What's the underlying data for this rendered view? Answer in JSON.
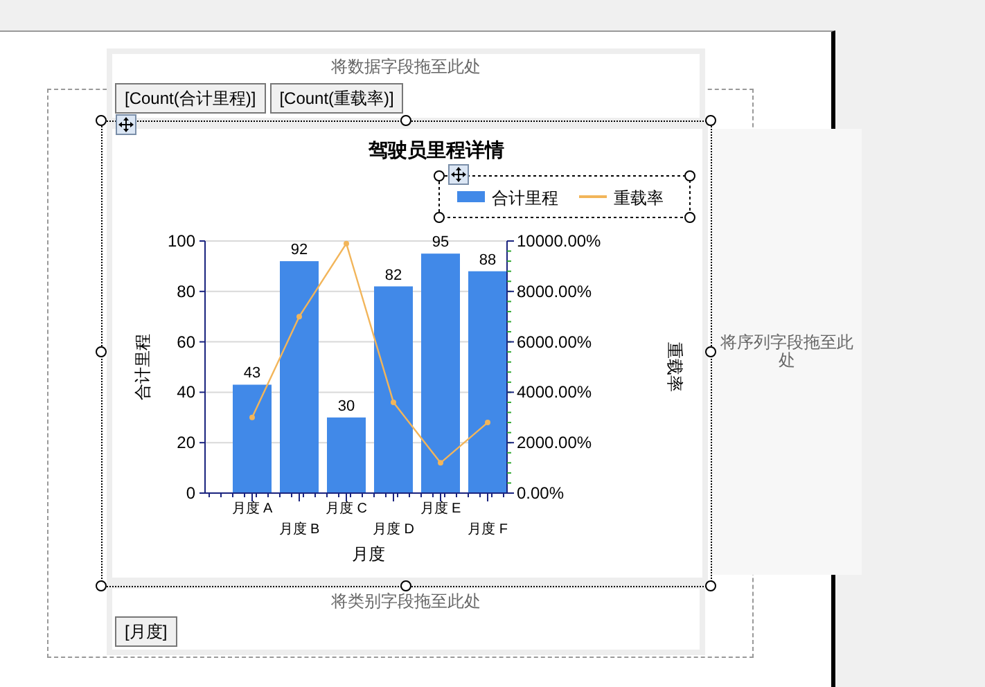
{
  "data_zone": {
    "hint": "将数据字段拖至此处",
    "fields": [
      "[Count(合计里程)]",
      "[Count(重载率)]"
    ]
  },
  "series_zone": {
    "hint": "将序列字段拖至此处"
  },
  "category_zone": {
    "hint": "将类别字段拖至此处",
    "fields": [
      "[月度]"
    ]
  },
  "chart": {
    "chart_data": {
      "type": "bar",
      "title": "驾驶员里程详情",
      "xlabel": "月度",
      "ylabel": "合计里程",
      "y2label": "重载率",
      "categories": [
        "月度 A",
        "月度 B",
        "月度 C",
        "月度 D",
        "月度 E",
        "月度 F"
      ],
      "series": [
        {
          "name": "合计里程",
          "type": "bar",
          "color": "#4189e8",
          "values": [
            43,
            92,
            30,
            82,
            95,
            88
          ],
          "value_labels": [
            "43",
            "92",
            "30",
            "82",
            "95",
            "88"
          ]
        },
        {
          "name": "重载率",
          "type": "line",
          "color": "#f2b55a",
          "values": [
            30,
            70,
            99,
            36,
            12,
            28
          ],
          "marker": true,
          "value_labels": [
            null,
            null,
            null,
            null,
            null,
            null
          ]
        }
      ],
      "ylim": [
        0,
        100
      ],
      "yticks": [
        0,
        20,
        40,
        60,
        80,
        100
      ],
      "y2lim": [
        0,
        100
      ],
      "y2ticks": [
        {
          "value": 0,
          "label": "0.00%"
        },
        {
          "value": 20,
          "label": "2000.00%"
        },
        {
          "value": 40,
          "label": "4000.00%"
        },
        {
          "value": 60,
          "label": "6000.00%"
        },
        {
          "value": 80,
          "label": "8000.00%"
        },
        {
          "value": 100,
          "label": "10000.00%"
        }
      ],
      "grid": true,
      "legend": true
    }
  }
}
